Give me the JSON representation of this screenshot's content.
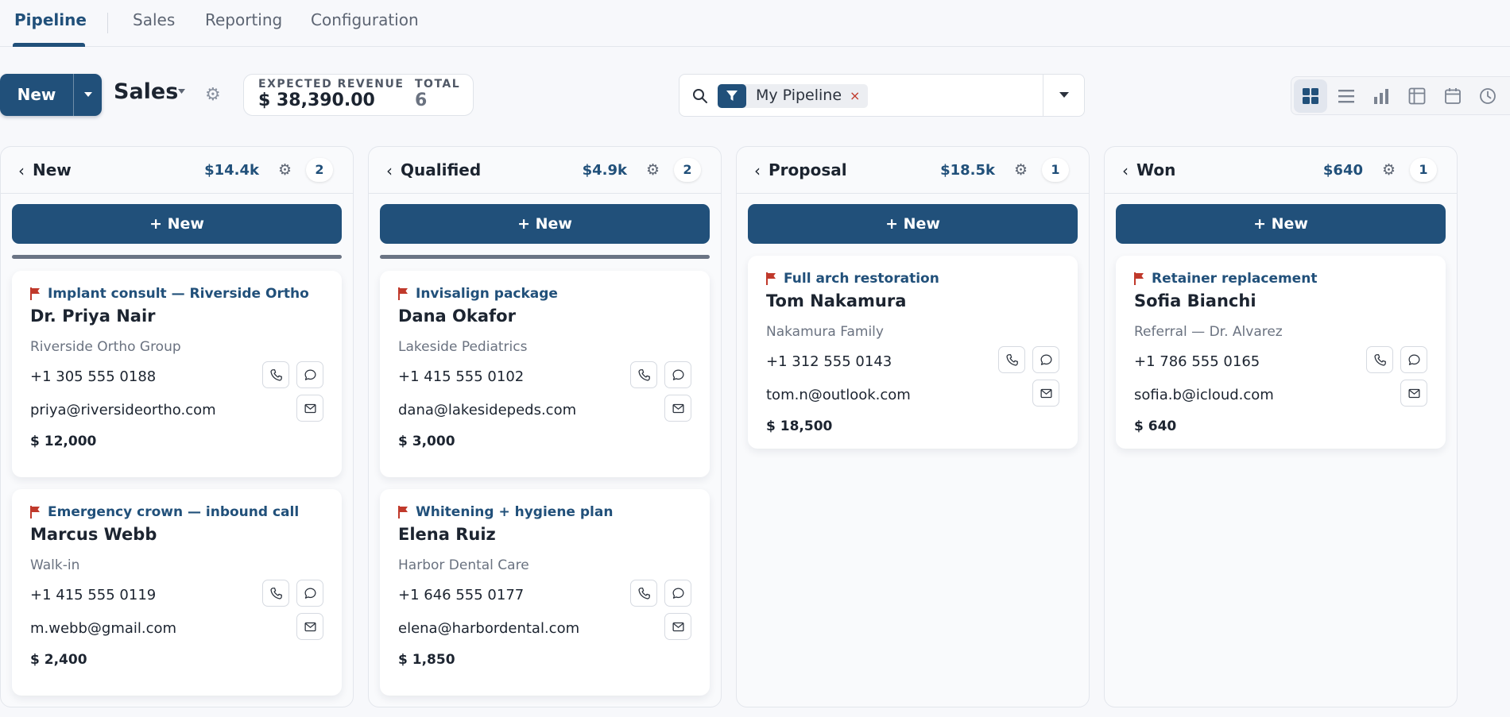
{
  "nav": {
    "items": [
      {
        "label": "Pipeline",
        "active": true
      },
      {
        "label": "Sales"
      },
      {
        "label": "Reporting"
      },
      {
        "label": "Configuration"
      }
    ]
  },
  "toolbar": {
    "new_label": "New",
    "view_title": "Sales",
    "revenue_label": "EXPECTED REVENUE",
    "revenue_value": "$ 38,390.00",
    "total_label": "TOTAL",
    "total_value": "6"
  },
  "search": {
    "facet_label": "My Pipeline",
    "facet_remove": "×",
    "placeholder": ""
  },
  "view_switcher": [
    "kanban-icon",
    "list-icon",
    "graph-icon",
    "pivot-icon",
    "calendar-icon",
    "activity-icon"
  ],
  "colors": {
    "accent": "#21507a",
    "flag": "#c0392b",
    "background": "#f7f8fb"
  },
  "columns": [
    {
      "title": "New",
      "amount": "$14.4k",
      "count": "2",
      "new_label": "+ New",
      "cards": [
        {
          "tag": "Implant consult — Riverside Ortho",
          "name": "Dr. Priya Nair",
          "company": "Riverside Ortho Group",
          "phone": "+1 305 555 0188",
          "email": "priya@riversideortho.com",
          "value": "$ 12,000"
        },
        {
          "tag": "Emergency crown — inbound call",
          "name": "Marcus Webb",
          "company": "Walk-in",
          "phone": "+1 415 555 0119",
          "email": "m.webb@gmail.com",
          "value": "$ 2,400"
        }
      ]
    },
    {
      "title": "Qualified",
      "amount": "$4.9k",
      "count": "2",
      "new_label": "+ New",
      "cards": [
        {
          "tag": "Invisalign package",
          "name": "Dana Okafor",
          "company": "Lakeside Pediatrics",
          "phone": "+1 415 555 0102",
          "email": "dana@lakesidepeds.com",
          "value": "$ 3,000"
        },
        {
          "tag": "Whitening + hygiene plan",
          "name": "Elena Ruiz",
          "company": "Harbor Dental Care",
          "phone": "+1 646 555 0177",
          "email": "elena@harbordental.com",
          "value": "$ 1,850"
        }
      ]
    },
    {
      "title": "Proposal",
      "amount": "$18.5k",
      "count": "1",
      "new_label": "+ New",
      "cards": [
        {
          "tag": "Full arch restoration",
          "name": "Tom Nakamura",
          "company": "Nakamura Family",
          "phone": "+1 312 555 0143",
          "email": "tom.n@outlook.com",
          "value": "$ 18,500"
        }
      ]
    },
    {
      "title": "Won",
      "amount": "$640",
      "count": "1",
      "new_label": "+ New",
      "cards": [
        {
          "tag": "Retainer replacement",
          "name": "Sofia Bianchi",
          "company": "Referral — Dr. Alvarez",
          "phone": "+1 786 555 0165",
          "email": "sofia.b@icloud.com",
          "value": "$ 640"
        }
      ]
    }
  ]
}
